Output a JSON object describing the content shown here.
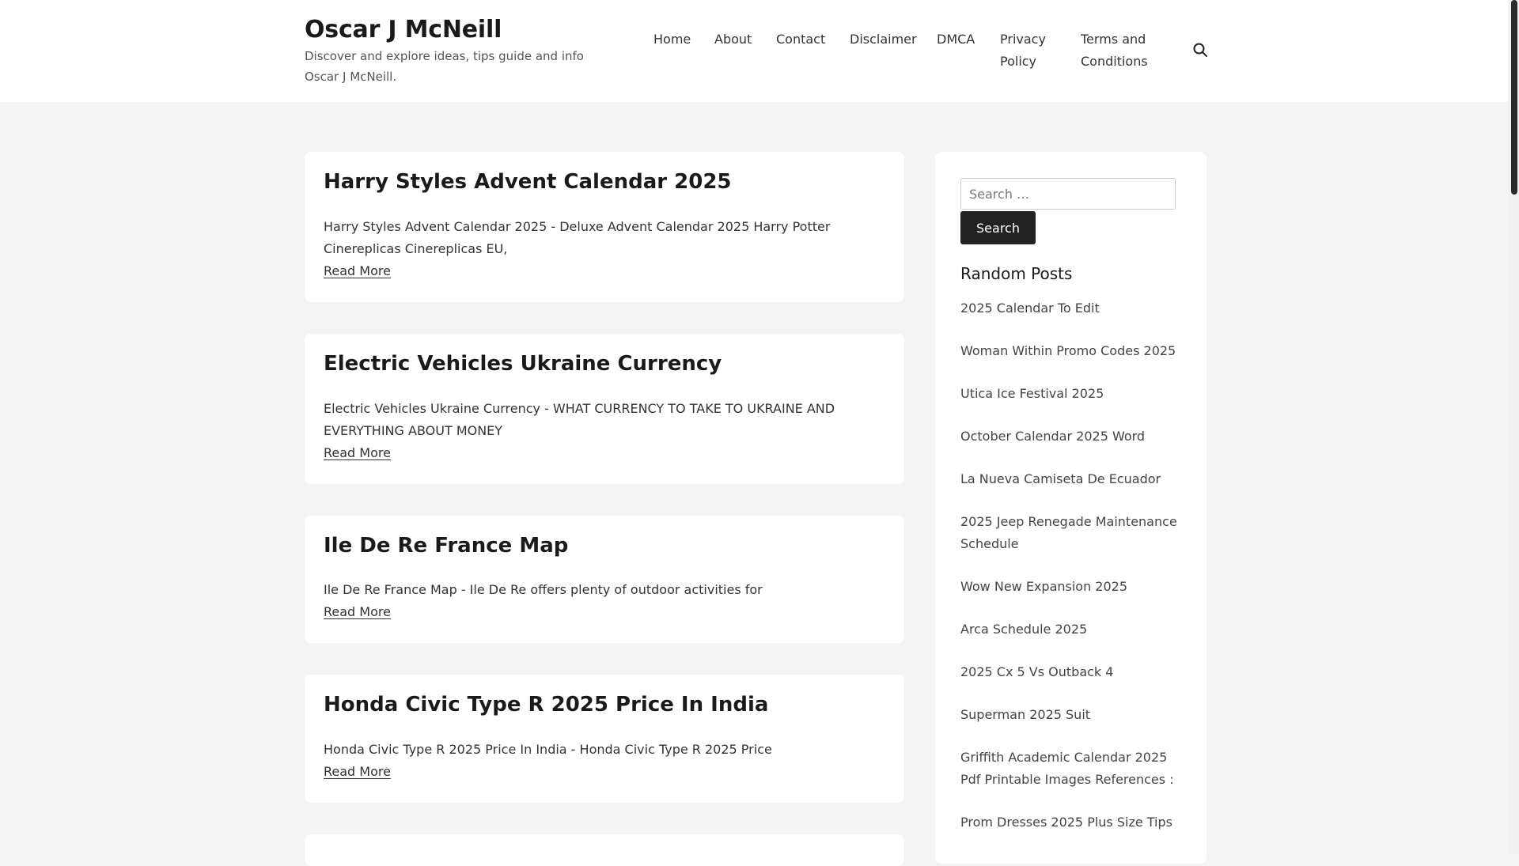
{
  "site": {
    "title": "Oscar J McNeill",
    "description": "Discover and explore ideas, tips guide and info Oscar J McNeill."
  },
  "nav": {
    "items": [
      {
        "label": "Home"
      },
      {
        "label": "About"
      },
      {
        "label": "Contact"
      },
      {
        "label": "Disclaimer"
      },
      {
        "label": "DMCA"
      },
      {
        "label": "Privacy Policy"
      },
      {
        "label": "Terms and Conditions"
      }
    ],
    "search_icon": "search-icon"
  },
  "posts": [
    {
      "title": "Harry Styles Advent Calendar 2025",
      "excerpt": "Harry Styles Advent Calendar 2025 - Deluxe Advent Calendar 2025 Harry Potter Cinereplicas Cinereplicas EU,",
      "read_more": "Read More"
    },
    {
      "title": "Electric Vehicles Ukraine Currency",
      "excerpt": "Electric Vehicles Ukraine Currency - WHAT CURRENCY TO TAKE TO UKRAINE AND EVERYTHING ABOUT MONEY",
      "read_more": "Read More"
    },
    {
      "title": "Ile De Re France Map",
      "excerpt": "Ile De Re France Map - Ile De Re offers plenty of outdoor activities for",
      "read_more": "Read More"
    },
    {
      "title": "Honda Civic Type R 2025 Price In India",
      "excerpt": "Honda Civic Type R 2025 Price In India - Honda Civic Type R 2025 Price",
      "read_more": "Read More"
    }
  ],
  "sidebar": {
    "search_placeholder": "Search …",
    "search_button": "Search",
    "random_title": "Random Posts",
    "random_posts": [
      "2025 Calendar To Edit",
      "Woman Within Promo Codes 2025",
      "Utica Ice Festival 2025",
      "October Calendar 2025 Word",
      "La Nueva Camiseta De Ecuador",
      "2025 Jeep Renegade Maintenance Schedule",
      "Wow New Expansion 2025",
      "Arca Schedule 2025",
      "2025 Cx 5 Vs Outback 4",
      "Superman 2025 Suit",
      "Griffith Academic Calendar 2025 Pdf Printable Images References :",
      "Prom Dresses 2025 Plus Size Tips"
    ]
  }
}
